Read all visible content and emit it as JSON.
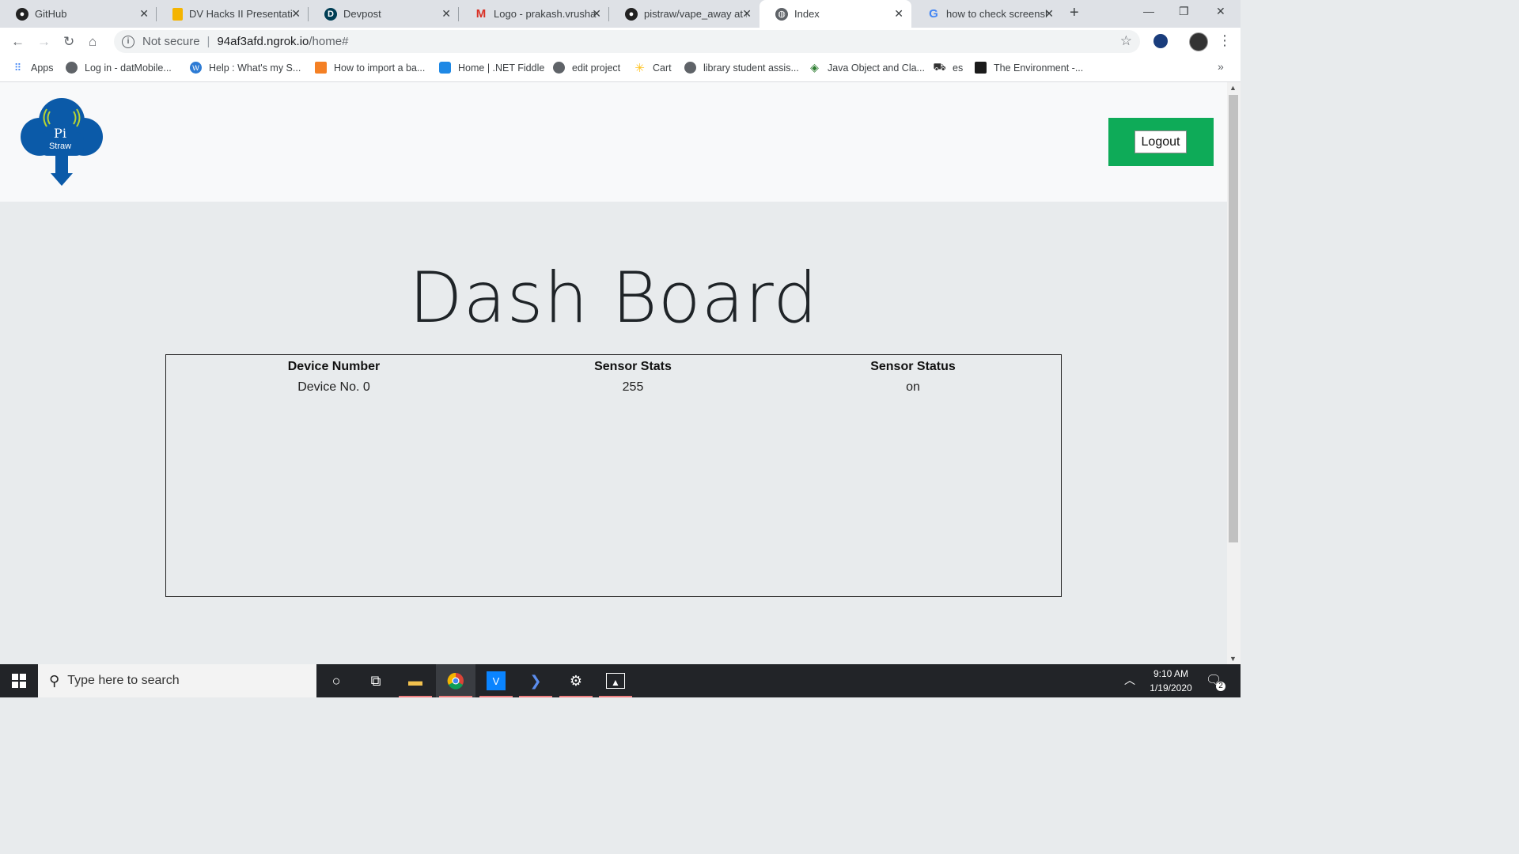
{
  "browser": {
    "tabs": [
      {
        "title": "GitHub",
        "icon": "github-icon"
      },
      {
        "title": "DV Hacks II Presentatio",
        "icon": "slides-icon"
      },
      {
        "title": "Devpost",
        "icon": "devpost-icon"
      },
      {
        "title": "Logo - prakash.vrushan",
        "icon": "gmail-icon"
      },
      {
        "title": "pistraw/vape_away at n",
        "icon": "github-icon"
      },
      {
        "title": "Index",
        "icon": "globe-icon"
      },
      {
        "title": "how to check screensh",
        "icon": "google-icon"
      }
    ],
    "active_tab": "Index",
    "address": {
      "security": "Not secure",
      "host": "94af3afd.ngrok.io",
      "path": "/home#"
    },
    "bookmarks": [
      "Apps",
      "Log in - datMobile...",
      "Help : What's my S...",
      "How to import a ba...",
      "Home | .NET Fiddle",
      "edit project",
      "Cart",
      "library student assis...",
      "Java Object and Cla...",
      "es",
      "The Environment -..."
    ]
  },
  "page": {
    "logo": {
      "line1": "Pi",
      "line2": "Straw",
      "color": "#0b5aa8"
    },
    "logout_label": "Logout",
    "title": "Dash Board",
    "table": {
      "headers": [
        "Device Number",
        "Sensor Stats",
        "Sensor Status"
      ],
      "rows": [
        [
          "Device No. 0",
          "255",
          "on"
        ]
      ]
    }
  },
  "taskbar": {
    "search_placeholder": "Type here to search",
    "time": "9:10 AM",
    "date": "1/19/2020",
    "notification_count": "2"
  },
  "colors": {
    "logout_bg": "#0eab58",
    "page_bg": "#e8ebed"
  }
}
